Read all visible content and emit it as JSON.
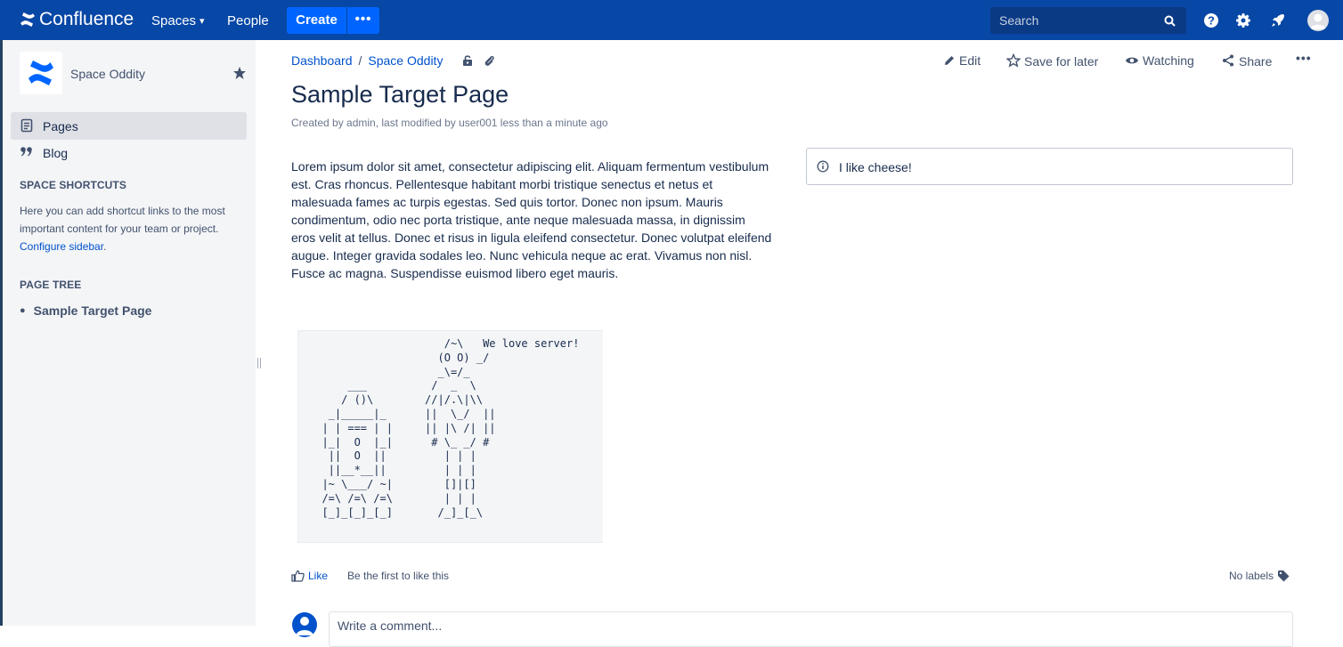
{
  "topbar": {
    "brand": "Confluence",
    "nav": {
      "spaces": "Spaces",
      "people": "People"
    },
    "create_label": "Create",
    "more_label": "•••",
    "search_placeholder": "Search",
    "icons": [
      "help-icon",
      "settings-icon",
      "notifications-rocket-icon",
      "user-avatar-icon"
    ]
  },
  "sidebar": {
    "space_name": "Space Oddity",
    "items": [
      {
        "label": "Pages",
        "icon": "pages-icon",
        "active": true
      },
      {
        "label": "Blog",
        "icon": "blog-quote-icon",
        "active": false
      }
    ],
    "shortcuts_heading": "SPACE SHORTCUTS",
    "shortcuts_text": "Here you can add shortcut links to the most important content for your team or project.",
    "configure_link": "Configure sidebar",
    "configure_suffix": ".",
    "tree_heading": "PAGE TREE",
    "tree_items": [
      "Sample Target Page"
    ]
  },
  "breadcrumb": {
    "items": [
      "Dashboard",
      "Space Oddity"
    ],
    "separator": "/"
  },
  "page_actions": {
    "edit": "Edit",
    "save_for_later": "Save for later",
    "watching": "Watching",
    "share": "Share",
    "more": "•••"
  },
  "page": {
    "title": "Sample Target Page",
    "byline": "Created by admin, last modified by user001 less than a minute ago",
    "body": "Lorem ipsum dolor sit amet, consectetur adipiscing elit. Aliquam fermentum vestibulum est. Cras rhoncus. Pellentesque habitant morbi tristique senectus et netus et malesuada fames ac turpis egestas. Sed quis tortor. Donec non ipsum. Mauris condimentum, odio nec porta tristique, ante neque malesuada massa, in dignissim eros velit at tellus. Donec et risus in ligula eleifend consectetur. Donec volutpat eleifend augue. Integer gravida sodales leo. Nunc vehicula neque ac erat. Vivamus non nisl. Fusce ac magna. Suspendisse euismod libero eget mauris.",
    "info_panel": "I like cheese!",
    "code_block": "                     /~\\   We love server!\n                    (O O) _/\n                    _\\=/_\n      ___          /  _  \\\n     / ()\\        //|/.\\|\\\\\n   _|_____|_      ||  \\_/  ||\n  | | === | |     || |\\ /| ||\n  |_|  O  |_|      # \\_ _/ #\n   ||  O  ||         | | |\n   ||__*__||         | | |\n  |~ \\___/ ~|        []|[]\n  /=\\ /=\\ /=\\        | | |\n  [_]_[_]_[_]       /_]_[_\\"
  },
  "footer": {
    "like": "Like",
    "like_text": "Be the first to like this",
    "labels": "No labels",
    "comment_placeholder": "Write a comment..."
  },
  "colors": {
    "topbar": "#0747a6",
    "create": "#0065ff",
    "link": "#0052cc",
    "sidebar": "#f4f5f7"
  }
}
